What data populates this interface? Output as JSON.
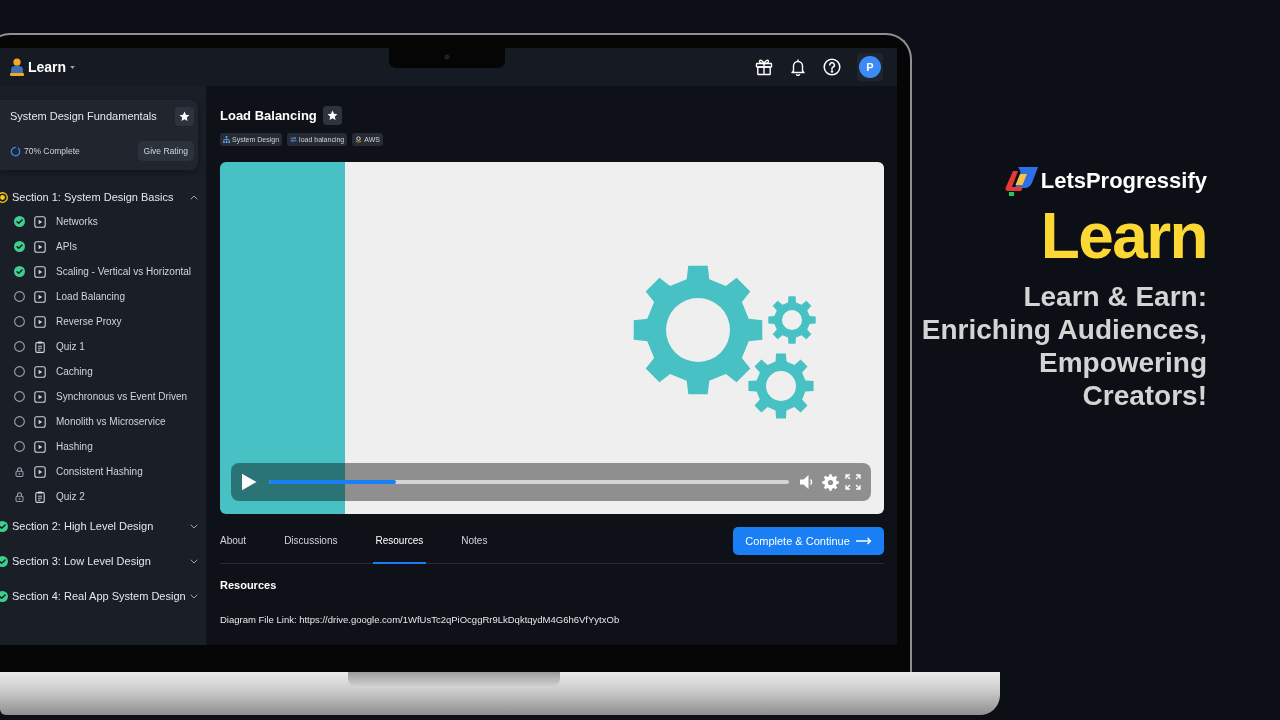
{
  "topbar": {
    "app_title": "Learn",
    "avatar_initial": "P"
  },
  "course": {
    "title": "System Design Fundamentals",
    "progress_label": "70% Complete",
    "rating_button": "Give Rating"
  },
  "sections": [
    {
      "title": "Section 1: System Design Basics",
      "completed": false,
      "expanded": true,
      "children": [
        {
          "title": "Networks",
          "completed": true,
          "locked": false,
          "kind": "video"
        },
        {
          "title": "APIs",
          "completed": true,
          "locked": false,
          "kind": "video"
        },
        {
          "title": "Scaling - Vertical vs Horizontal",
          "completed": true,
          "locked": false,
          "kind": "video"
        },
        {
          "title": "Load Balancing",
          "completed": false,
          "locked": false,
          "kind": "video"
        },
        {
          "title": "Reverse Proxy",
          "completed": false,
          "locked": false,
          "kind": "video"
        },
        {
          "title": "Quiz 1",
          "completed": false,
          "locked": false,
          "kind": "quiz"
        },
        {
          "title": "Caching",
          "completed": false,
          "locked": false,
          "kind": "video"
        },
        {
          "title": "Synchronous vs Event Driven",
          "completed": false,
          "locked": false,
          "kind": "video"
        },
        {
          "title": "Monolith vs Microservice",
          "completed": false,
          "locked": false,
          "kind": "video"
        },
        {
          "title": "Hashing",
          "completed": false,
          "locked": false,
          "kind": "video"
        },
        {
          "title": "Consistent Hashing",
          "completed": false,
          "locked": true,
          "kind": "video"
        },
        {
          "title": "Quiz 2",
          "completed": false,
          "locked": true,
          "kind": "quiz"
        }
      ]
    },
    {
      "title": "Section 2: High Level Design",
      "completed": true,
      "expanded": false
    },
    {
      "title": "Section 3: Low Level Design",
      "completed": true,
      "expanded": false
    },
    {
      "title": "Section 4: Real App System Design",
      "completed": true,
      "expanded": false
    }
  ],
  "lesson": {
    "title": "Load Balancing",
    "tags": [
      {
        "label": "System Design",
        "kind": "hierarchy"
      },
      {
        "label": "load balancing",
        "kind": "arrows"
      },
      {
        "label": "AWS",
        "kind": "cloud"
      }
    ]
  },
  "player": {
    "progress": {
      "level": 0.244
    }
  },
  "tabs": [
    {
      "label": "About",
      "selected": false
    },
    {
      "label": "Discussions",
      "selected": false
    },
    {
      "label": "Resources",
      "selected": true
    },
    {
      "label": "Notes",
      "selected": false
    }
  ],
  "continue_button": "Complete & Continue",
  "resources": {
    "heading": "Resources",
    "text": "Diagram File Link: https://drive.google.com/1WfUsTc2qPiOcggRr9LkDqktqydM4G6h6VfYytxOb"
  },
  "branding": {
    "brand_name": "LetsProgressify",
    "headline": "Learn",
    "tagline": [
      "Learn & Earn:",
      "Enriching Audiences,",
      "Empowering",
      "Creators!"
    ]
  }
}
